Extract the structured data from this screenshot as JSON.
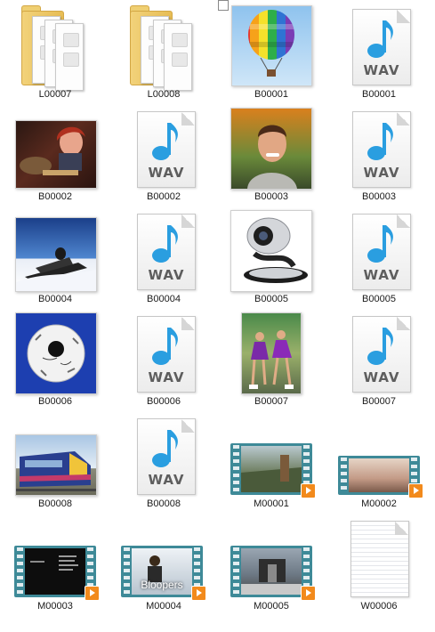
{
  "files": [
    {
      "name": "L00007",
      "kind": "folder"
    },
    {
      "name": "L00008",
      "kind": "folder"
    },
    {
      "name": "B00001",
      "kind": "image",
      "subject": "hot-air-balloon"
    },
    {
      "name": "B00001",
      "kind": "wav"
    },
    {
      "name": "B00002",
      "kind": "image",
      "subject": "animated-characters"
    },
    {
      "name": "B00002",
      "kind": "wav"
    },
    {
      "name": "B00003",
      "kind": "image",
      "subject": "smiling-man"
    },
    {
      "name": "B00003",
      "kind": "wav"
    },
    {
      "name": "B00004",
      "kind": "image",
      "subject": "snowmobile"
    },
    {
      "name": "B00004",
      "kind": "wav"
    },
    {
      "name": "B00005",
      "kind": "image",
      "subject": "webcam"
    },
    {
      "name": "B00005",
      "kind": "wav"
    },
    {
      "name": "B00006",
      "kind": "image",
      "subject": "soccer-ball"
    },
    {
      "name": "B00006",
      "kind": "wav"
    },
    {
      "name": "B00007",
      "kind": "image",
      "subject": "dancers"
    },
    {
      "name": "B00007",
      "kind": "wav"
    },
    {
      "name": "B00008",
      "kind": "image",
      "subject": "train"
    },
    {
      "name": "B00008",
      "kind": "wav"
    },
    {
      "name": "M00001",
      "kind": "video"
    },
    {
      "name": "M00002",
      "kind": "video"
    },
    {
      "name": "M00003",
      "kind": "video"
    },
    {
      "name": "M00004",
      "kind": "video",
      "overlay_text": "Bloopers"
    },
    {
      "name": "M00005",
      "kind": "video"
    },
    {
      "name": "W00006",
      "kind": "text"
    }
  ],
  "wav_label": "WAV",
  "colors": {
    "note_blue": "#2a9ee0",
    "video_frame": "#3e8a98",
    "play_badge": "#f28a1c",
    "folder_yellow": "#f0cd6b"
  }
}
